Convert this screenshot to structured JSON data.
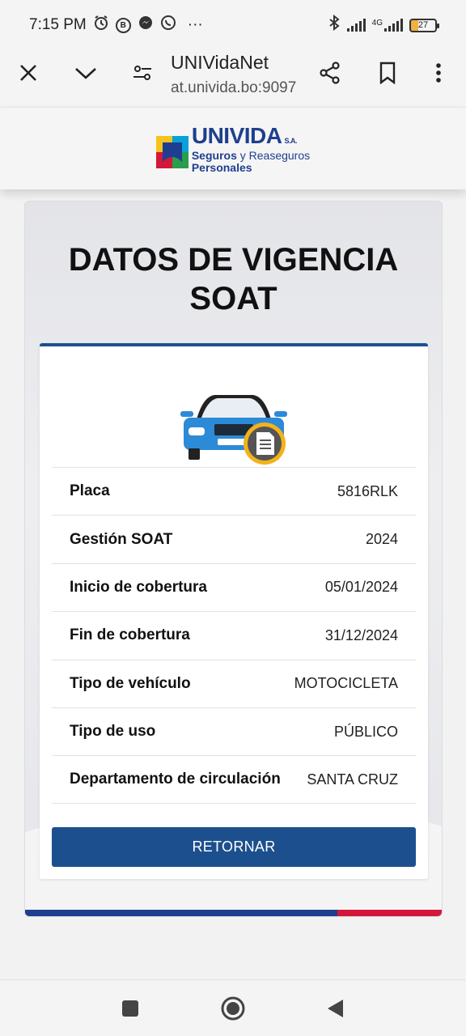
{
  "status_bar": {
    "time": "7:15 PM",
    "more": "···",
    "network": "4G",
    "battery": "27"
  },
  "browser": {
    "title": "UNIVidaNet",
    "url": "at.univida.bo:9097"
  },
  "brand": {
    "name": "UNIVIDA",
    "suffix": "S.A.",
    "tagline_bold": "Seguros",
    "tagline_rest": " y Reaseguros",
    "tagline2": "Personales",
    "colors": {
      "blue": "#1e3f8f",
      "red": "#d2173a"
    }
  },
  "page": {
    "title_line1": "DATOS DE VIGENCIA",
    "title_line2": "SOAT"
  },
  "details": [
    {
      "label": "Placa",
      "value": "5816RLK"
    },
    {
      "label": "Gestión SOAT",
      "value": "2024"
    },
    {
      "label": "Inicio de cobertura",
      "value": "05/01/2024"
    },
    {
      "label": "Fin de cobertura",
      "value": "31/12/2024"
    },
    {
      "label": "Tipo de vehículo",
      "value": "MOTOCICLETA"
    },
    {
      "label": "Tipo de uso",
      "value": "PÚBLICO"
    },
    {
      "label": "Departamento de circulación",
      "value": "SANTA CRUZ"
    }
  ],
  "actions": {
    "return_label": "RETORNAR"
  }
}
